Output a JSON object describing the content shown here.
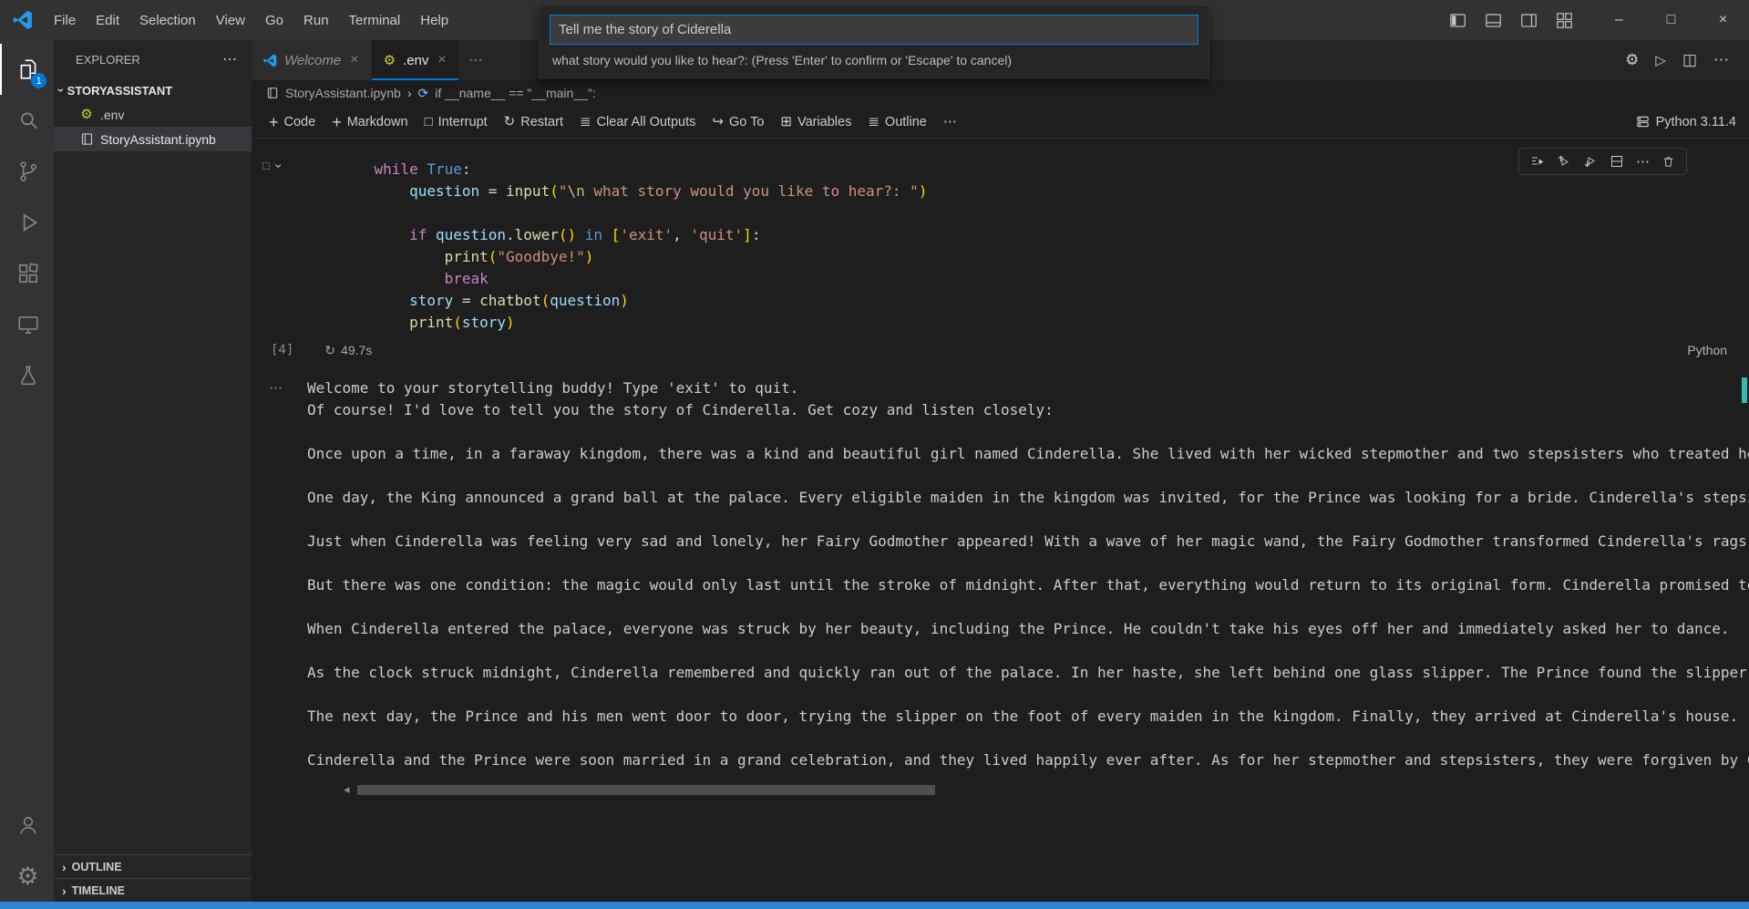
{
  "titlebar": {
    "menus": [
      "File",
      "Edit",
      "Selection",
      "View",
      "Go",
      "Run",
      "Terminal",
      "Help"
    ]
  },
  "quick_input": {
    "value": "Tell me the story of Ciderella",
    "prompt": "what story would you like to hear?: (Press 'Enter' to confirm or 'Escape' to cancel)"
  },
  "activity_bar": {
    "explorer_badge": "1"
  },
  "sidebar": {
    "title": "EXPLORER",
    "section": "STORYASSISTANT",
    "files": [
      {
        "name": ".env",
        "icon": "gear-icon"
      },
      {
        "name": "StoryAssistant.ipynb",
        "icon": "notebook-icon",
        "selected": true
      }
    ],
    "panels": [
      {
        "label": "OUTLINE"
      },
      {
        "label": "TIMELINE"
      }
    ]
  },
  "tabs": [
    {
      "label": "Welcome",
      "icon": "vscode-icon",
      "preview": true
    },
    {
      "label": ".env",
      "icon": "gear-icon",
      "active": true
    }
  ],
  "breadcrumb": {
    "file": "StoryAssistant.ipynb",
    "symbol": "if __name__ == \"__main__\":"
  },
  "nbtoolbar": {
    "code": "Code",
    "markdown": "Markdown",
    "interrupt": "Interrupt",
    "restart": "Restart",
    "clear": "Clear All Outputs",
    "goto": "Go To",
    "variables": "Variables",
    "outline": "Outline",
    "kernel": "Python 3.11.4"
  },
  "cell": {
    "execution_count": "[4]",
    "duration": "49.7s",
    "language": "Python",
    "code_lines": [
      [
        {
          "t": "    "
        },
        {
          "t": "while",
          "c": "kw"
        },
        {
          "t": " "
        },
        {
          "t": "True",
          "c": "kwb"
        },
        {
          "t": ":"
        }
      ],
      [
        {
          "t": "        "
        },
        {
          "t": "question",
          "c": "var"
        },
        {
          "t": " = "
        },
        {
          "t": "input",
          "c": "fn"
        },
        {
          "t": "(",
          "c": "brk"
        },
        {
          "t": "\"",
          "c": "str"
        },
        {
          "t": "\\n",
          "c": "esc"
        },
        {
          "t": " what story would you like to hear?: ",
          "c": "str"
        },
        {
          "t": "\"",
          "c": "str"
        },
        {
          "t": ")",
          "c": "brk"
        }
      ],
      [],
      [
        {
          "t": "        "
        },
        {
          "t": "if",
          "c": "kw"
        },
        {
          "t": " "
        },
        {
          "t": "question",
          "c": "var"
        },
        {
          "t": "."
        },
        {
          "t": "lower",
          "c": "fn"
        },
        {
          "t": "(",
          "c": "brk"
        },
        {
          "t": ")",
          "c": "brk"
        },
        {
          "t": " "
        },
        {
          "t": "in",
          "c": "kwb"
        },
        {
          "t": " "
        },
        {
          "t": "[",
          "c": "brk"
        },
        {
          "t": "'exit'",
          "c": "str"
        },
        {
          "t": ", "
        },
        {
          "t": "'quit'",
          "c": "str"
        },
        {
          "t": "]",
          "c": "brk"
        },
        {
          "t": ":"
        }
      ],
      [
        {
          "t": "            "
        },
        {
          "t": "print",
          "c": "fn"
        },
        {
          "t": "(",
          "c": "brk"
        },
        {
          "t": "\"Goodbye!\"",
          "c": "str"
        },
        {
          "t": ")",
          "c": "brk"
        }
      ],
      [
        {
          "t": "            "
        },
        {
          "t": "break",
          "c": "kw"
        }
      ],
      [
        {
          "t": "        "
        },
        {
          "t": "story",
          "c": "var"
        },
        {
          "t": " = "
        },
        {
          "t": "chatbot",
          "c": "fn"
        },
        {
          "t": "(",
          "c": "brk"
        },
        {
          "t": "question",
          "c": "var"
        },
        {
          "t": ")",
          "c": "brk"
        }
      ],
      [
        {
          "t": "        "
        },
        {
          "t": "print",
          "c": "fn"
        },
        {
          "t": "(",
          "c": "brk"
        },
        {
          "t": "story",
          "c": "var"
        },
        {
          "t": ")",
          "c": "brk"
        }
      ]
    ]
  },
  "output": {
    "lines": [
      "Welcome to your storytelling buddy! Type 'exit' to quit.",
      "Of course! I'd love to tell you the story of Cinderella. Get cozy and listen closely:",
      "",
      "Once upon a time, in a faraway kingdom, there was a kind and beautiful girl named Cinderella. She lived with her wicked stepmother and two stepsisters who treated her poorly.",
      "",
      "One day, the King announced a grand ball at the palace. Every eligible maiden in the kingdom was invited, for the Prince was looking for a bride. Cinderella's stepsisters were thrilled.",
      "",
      "Just when Cinderella was feeling very sad and lonely, her Fairy Godmother appeared! With a wave of her magic wand, the Fairy Godmother transformed Cinderella's rags into a gown.",
      "",
      "But there was one condition: the magic would only last until the stroke of midnight. After that, everything would return to its original form. Cinderella promised to remember.",
      "",
      "When Cinderella entered the palace, everyone was struck by her beauty, including the Prince. He couldn't take his eyes off her and immediately asked her to dance.",
      "",
      "As the clock struck midnight, Cinderella remembered and quickly ran out of the palace. In her haste, she left behind one glass slipper. The Prince found the slipper.",
      "",
      "The next day, the Prince and his men went door to door, trying the slipper on the foot of every maiden in the kingdom. Finally, they arrived at Cinderella's house.",
      "",
      "Cinderella and the Prince were soon married in a grand celebration, and they lived happily ever after. As for her stepmother and stepsisters, they were forgiven by Cinderella."
    ]
  },
  "icons": {
    "more": "⋯",
    "chevron_right": "›",
    "close": "×",
    "minimize": "–",
    "maximize": "□",
    "gear": "⚙",
    "play": "▷",
    "split_editor": "◫",
    "interrupt": "□",
    "restart": "↻",
    "goto": "↪",
    "variables": "⊞",
    "outline_list": "≣",
    "plus": "+",
    "scroll_left": "◂",
    "exec_refresh": "↻",
    "symbol": "⟳",
    "collapse_square": "□"
  },
  "colors": {
    "accent": "#0078d4",
    "statusbar": "#3186d1",
    "badge": "#0078d4",
    "input_border": "#007fd4"
  }
}
